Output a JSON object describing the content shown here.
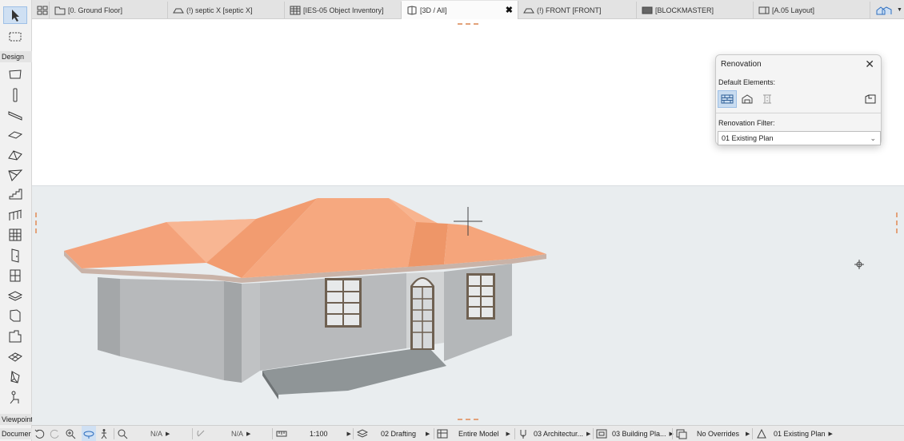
{
  "toolbox": {
    "design_label": "Design",
    "viewpoint_label": "Viewpoint",
    "document_label": "Documer"
  },
  "tabs": [
    {
      "label": "",
      "icon": "tab-grid-icon"
    },
    {
      "label": "[0. Ground Floor]",
      "icon": "floor-plan-icon"
    },
    {
      "label": "(!) septic X [septic X]",
      "icon": "section-icon"
    },
    {
      "label": "[IES-05 Object Inventory]",
      "icon": "schedule-icon"
    },
    {
      "label": "[3D / All]",
      "icon": "3d-view-icon",
      "active": true
    },
    {
      "label": "(!) FRONT [FRONT]",
      "icon": "elevation-icon"
    },
    {
      "label": "[BLOCKMASTER]",
      "icon": "layout-icon"
    },
    {
      "label": "[A.05 Layout]",
      "icon": "layout-sheet-icon"
    }
  ],
  "tab_close": "✖",
  "renovation": {
    "title": "Renovation",
    "close": "✕",
    "default_elements_label": "Default Elements:",
    "filter_label": "Renovation Filter:",
    "filter_value": "01 Existing Plan"
  },
  "statusbar": {
    "na1": "N/A",
    "na2": "N/A",
    "scale": "1:100",
    "layer_combo": "02 Drafting",
    "model_view": "Entire Model",
    "pen_set": "03 Architectur...",
    "mvo": "03 Building Pla...",
    "overrides": "No Overrides",
    "renovation_filter": "01 Existing Plan"
  },
  "colors": {
    "roof": "#f4a27a",
    "wall": "#b7b9bb",
    "ground": "#e9edef",
    "accent": "#2f6fbf"
  }
}
